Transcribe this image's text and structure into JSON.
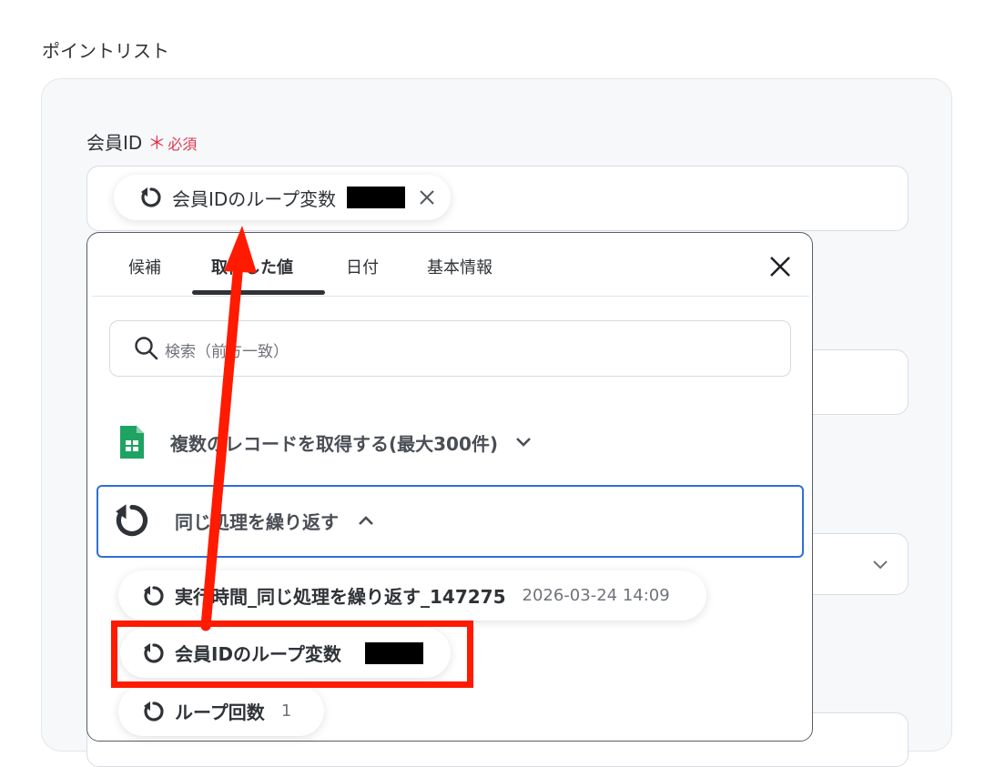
{
  "section": {
    "title": "ポイントリスト"
  },
  "field": {
    "label": "会員ID",
    "required_mark": "＊",
    "required_text": "必須",
    "chip_label": "会員IDのループ変数"
  },
  "dropdown": {
    "tabs": [
      {
        "label": "候補"
      },
      {
        "label": "取得した値"
      },
      {
        "label": "日付"
      },
      {
        "label": "基本情報"
      }
    ],
    "active_tab": 1,
    "search_placeholder": "検索（前方一致）",
    "groups": [
      {
        "label": "複数のレコードを取得する(最大300件)",
        "expanded": false,
        "icon": "spreadsheet-icon"
      },
      {
        "label": "同じ処理を繰り返す",
        "expanded": true,
        "icon": "loop-icon"
      }
    ],
    "items": [
      {
        "label": "実行時間_同じ処理を繰り返す_147275",
        "value": "2026-03-24 14:09"
      },
      {
        "label": "会員IDのループ変数",
        "value": ""
      },
      {
        "label": "ループ回数",
        "value": "1"
      }
    ]
  },
  "colors": {
    "accent_blue": "#2f6fd6",
    "required_red": "#e0374c",
    "annotation_red": "#ff1a00",
    "sheets_green": "#1ea362"
  }
}
